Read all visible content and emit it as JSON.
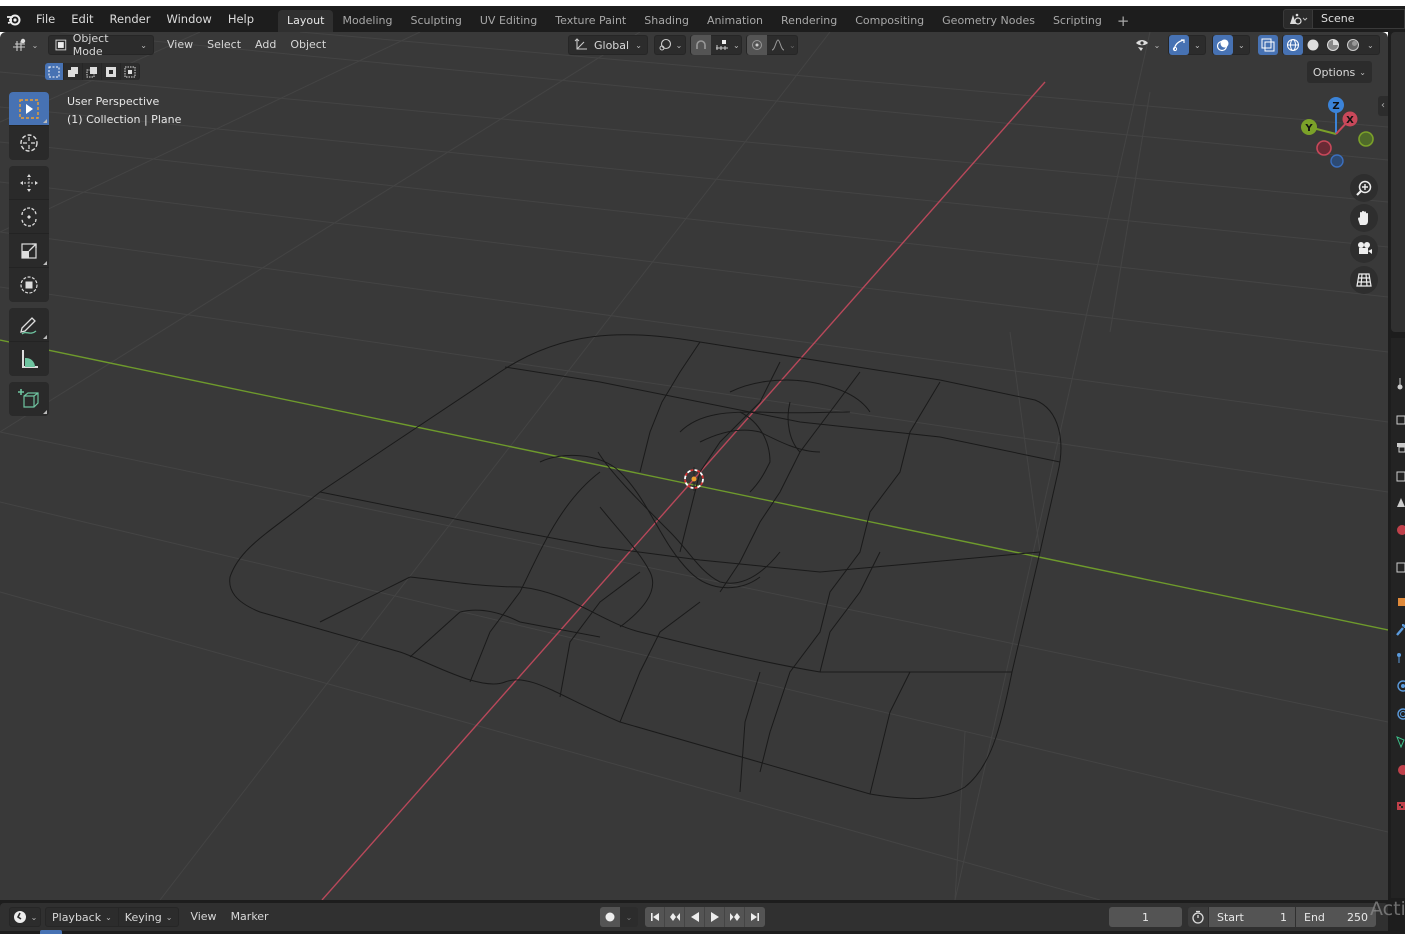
{
  "app": {
    "name": "Blender"
  },
  "top_menu": {
    "items": [
      "File",
      "Edit",
      "Render",
      "Window",
      "Help"
    ]
  },
  "workspaces": {
    "tabs": [
      {
        "label": "Layout",
        "active": true
      },
      {
        "label": "Modeling",
        "active": false
      },
      {
        "label": "Sculpting",
        "active": false
      },
      {
        "label": "UV Editing",
        "active": false
      },
      {
        "label": "Texture Paint",
        "active": false
      },
      {
        "label": "Shading",
        "active": false
      },
      {
        "label": "Animation",
        "active": false
      },
      {
        "label": "Rendering",
        "active": false
      },
      {
        "label": "Compositing",
        "active": false
      },
      {
        "label": "Geometry Nodes",
        "active": false
      },
      {
        "label": "Scripting",
        "active": false
      }
    ],
    "add_label": "+"
  },
  "scene": {
    "name": "Scene"
  },
  "viewport_header": {
    "editor_type_icon": "3d-viewport-icon",
    "mode": "Object Mode",
    "menus": [
      "View",
      "Select",
      "Add",
      "Object"
    ],
    "transform_orientation": "Global",
    "pivot_icon": "pivot-icon",
    "snap_icon": "magnet-icon",
    "snap_target_icon": "snap-increment-icon",
    "proportional_icon": "proportional-edit-icon",
    "falloff_icon": "falloff-curve-icon",
    "options_label": "Options"
  },
  "select_modes": [
    "set-new",
    "extend",
    "subtract",
    "difference",
    "intersect"
  ],
  "viewport_overlay": {
    "view_name": "User Perspective",
    "object_info": "(1) Collection | Plane"
  },
  "tools": [
    {
      "name": "select-box",
      "active": true
    },
    {
      "name": "cursor",
      "active": false
    },
    {
      "name": "move",
      "active": false
    },
    {
      "name": "rotate",
      "active": false
    },
    {
      "name": "scale",
      "active": false
    },
    {
      "name": "transform",
      "active": false
    },
    {
      "name": "annotate",
      "active": false
    },
    {
      "name": "measure",
      "active": false
    },
    {
      "name": "add-cube",
      "active": false
    }
  ],
  "gizmo": {
    "axes": [
      "X",
      "Y",
      "Z"
    ]
  },
  "shading": {
    "modes": [
      "wireframe",
      "solid",
      "material-preview",
      "rendered"
    ],
    "active": "wireframe"
  },
  "colors": {
    "accent": "#4772b3",
    "x_axis": "#c8485a",
    "y_axis": "#7ba129",
    "z_axis": "#3b83d8",
    "viewport_bg": "#393939",
    "header_bg": "#1d1d1d"
  },
  "timeline": {
    "editor_icon": "timeline-clock-icon",
    "menus": [
      "Playback",
      "Keying",
      "View",
      "Marker"
    ],
    "current_frame": "1",
    "start_label": "Start",
    "start_value": "1",
    "end_label": "End",
    "end_value": "250"
  },
  "watermark": {
    "text": "Acti"
  }
}
